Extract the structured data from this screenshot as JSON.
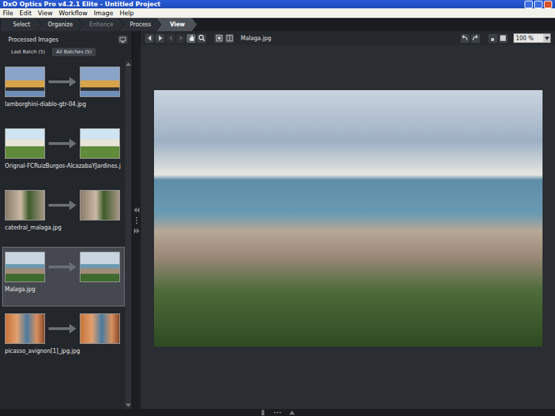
{
  "window": {
    "title": "DxO Optics Pro v4.2.1 Elite - Untitled Project"
  },
  "menu": [
    "File",
    "Edit",
    "View",
    "Workflow",
    "Image",
    "Help"
  ],
  "workflow_tabs": [
    {
      "label": "Select",
      "selected": false,
      "disabled": false
    },
    {
      "label": "Organize",
      "selected": false,
      "disabled": false
    },
    {
      "label": "Enhance",
      "selected": false,
      "disabled": true
    },
    {
      "label": "Process",
      "selected": false,
      "disabled": false
    },
    {
      "label": "View",
      "selected": true,
      "disabled": false
    }
  ],
  "sidebar": {
    "title": "Processed Images",
    "batch_tabs": [
      {
        "label": "Last Batch (5)",
        "selected": false
      },
      {
        "label": "All Batches (5)",
        "selected": true
      }
    ],
    "items": [
      {
        "name": "lamborghini-diablo-gtr-04.jpg",
        "selected": false
      },
      {
        "name": "Orignal-FCRuizBurgos-AlcazabaYJardines.j",
        "selected": false
      },
      {
        "name": "catedral_malaga.jpg",
        "selected": false
      },
      {
        "name": "Malaga.jpg",
        "selected": true
      },
      {
        "name": "picasso_avignon[1]_jpg.jpg",
        "selected": false
      }
    ]
  },
  "viewer": {
    "filename": "Malaga.jpg",
    "zoom": "100 %"
  }
}
